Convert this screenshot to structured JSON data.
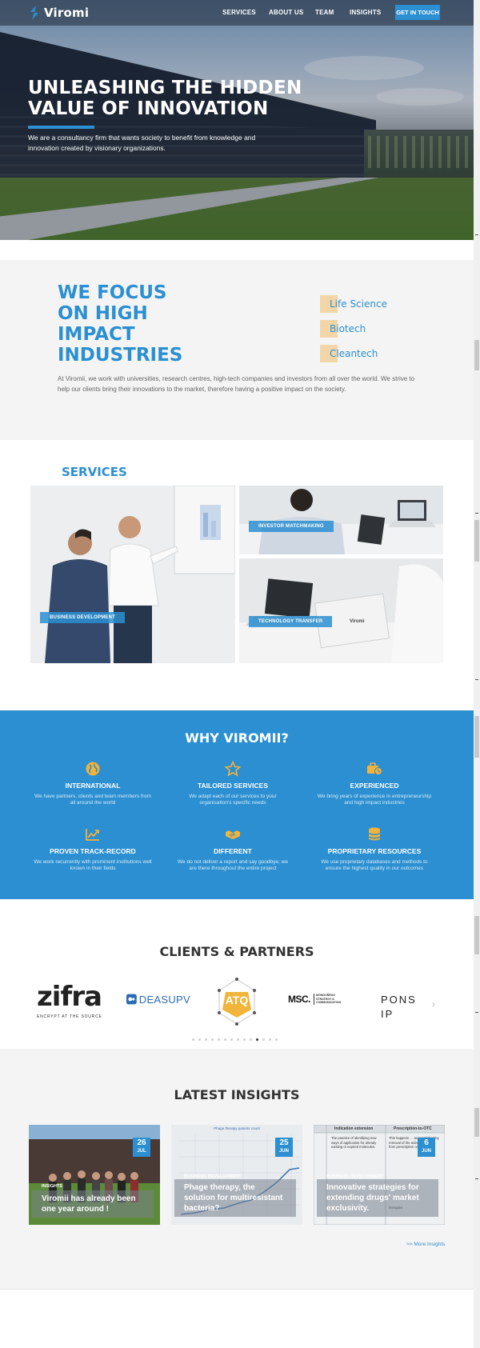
{
  "header": {
    "logo_text": "Viromi",
    "nav": [
      {
        "label": "SERVICES"
      },
      {
        "label": "ABOUT US"
      },
      {
        "label": "TEAM"
      },
      {
        "label": "INSIGHTS"
      }
    ],
    "cta_label": "GET IN TOUCH"
  },
  "hero": {
    "title": "UNLEASHING THE HIDDEN VALUE OF INNOVATION",
    "subtitle": "We are a consultancy firm that wants society to benefit from knowledge and innovation created by visionary organizations."
  },
  "focus": {
    "title": "WE FOCUS ON HIGH IMPACT INDUSTRIES",
    "industries": [
      {
        "label": "Life Science"
      },
      {
        "label": "Biotech"
      },
      {
        "label": "Cleantech"
      }
    ],
    "text": "At Viromii, we work with universities, research centres, high-tech companies and investors from all over the world. We strive to help our clients bring their innovations to the market, therefore having a positive impact on the society."
  },
  "services": {
    "title": "SERVICES",
    "items": [
      {
        "label": "BUSINESS DEVELOPMENT"
      },
      {
        "label": "INVESTOR MATCHMAKING"
      },
      {
        "label": "TECHNOLOGY TRANSFER"
      }
    ],
    "laptop_brand": "Viromi"
  },
  "why": {
    "title": "WHY VIROMII?",
    "items": [
      {
        "title": "INTERNATIONAL",
        "text": "We have partners, clients and team members from all around the world",
        "icon": "globe-icon"
      },
      {
        "title": "TAILORED SERVICES",
        "text": "We adapt each of our services to your organisation's specific needs",
        "icon": "star-icon"
      },
      {
        "title": "EXPERIENCED",
        "text": "We bring years of experience in entrepreneurship and high impact industries",
        "icon": "briefcase-clock-icon"
      },
      {
        "title": "PROVEN TRACK-RECORD",
        "text": "We work recurrently with prominent institutions well known in their fields",
        "icon": "chart-icon"
      },
      {
        "title": "DIFFERENT",
        "text": "We do not deliver a report and say goodbye; we are there throughout the entire project",
        "icon": "handshake-icon"
      },
      {
        "title": "PROPRIETARY RESOURCES",
        "text": "We use proprietary databases and methods to ensure the highest quality in our outcomes",
        "icon": "database-icon"
      }
    ],
    "colors": {
      "background": "#2b8fd1"
    }
  },
  "clients": {
    "title": "CLIENTS & PARTNERS",
    "logos": [
      {
        "name": "zifra",
        "tagline": "ENCRYPT AT THE SOURCE"
      },
      {
        "name": "DEASUPV"
      },
      {
        "name": "ATQ"
      },
      {
        "name": "MSC.",
        "tagline": "MONDOÑEDO STRATEGY & COMMUNICATION"
      },
      {
        "name": "PONS IP"
      }
    ],
    "dots_total": 14,
    "dots_active": 10
  },
  "insights": {
    "title": "LATEST INSIGHTS",
    "cards": [
      {
        "day": "26",
        "month": "JUL",
        "tag": "INSIGHTS",
        "title": "Viromii has already been one year around !"
      },
      {
        "day": "25",
        "month": "JUN",
        "tag": "BUSINESS DEVELOPMENT",
        "title": "Phage therapy, the solution for multiresistant bacteria?",
        "chart_caption": "Phage therapy patents count"
      },
      {
        "day": "6",
        "month": "JUN",
        "tag": "BUSINESS DEVELOPMENT",
        "title": "Innovative strategies for extending drugs' market exclusivity.",
        "table_headers": [
          "Indication extension",
          "Prescription-to-OTC"
        ],
        "table_cells": [
          "The practice of identifying new ways of application for already existing or expired molecules.",
          "This happens … accomplished by removal of the active ingredient from prescription only status.",
          "therapies"
        ]
      }
    ],
    "more_label": ">> More Insights"
  },
  "colors": {
    "accent": "#2b8fd1",
    "industry_square": "#f3d6a7"
  }
}
